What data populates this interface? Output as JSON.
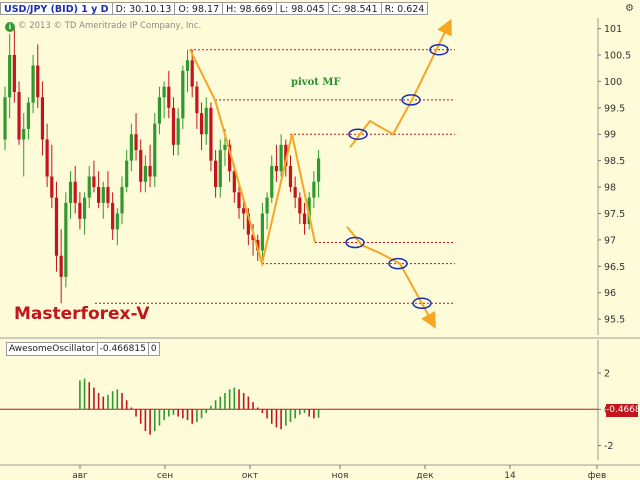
{
  "header": {
    "symbol": "USD/JPY (BID) 1 y D",
    "date": "D: 30.10.13",
    "open": "O: 98.17",
    "high": "H: 98.669",
    "low": "L: 98.045",
    "close": "C: 98.541",
    "range": "R: 0.624"
  },
  "copyright": "© 2013 © TD Ameritrade IP Company, Inc.",
  "signature": "Masterforex-V",
  "pivot_label": "pivot MF",
  "oscillator": {
    "name": "AwesomeOscillator",
    "value": "-0.466815",
    "extra": "0",
    "last_value": "-0.4668"
  },
  "colors": {
    "background": "#fdfbd8",
    "up_candle": "#2e9a2e",
    "down_candle": "#c4141c",
    "forecast": "#f5a623",
    "level_line": "#c4141c",
    "ellipse": "#1a2fb0"
  },
  "chart_data": [
    {
      "type": "candlestick",
      "title": "USD/JPY (BID) 1 y D",
      "ylim": [
        95.2,
        101.2
      ],
      "yticks": [
        95.5,
        96,
        96.5,
        97,
        97.5,
        98,
        98.5,
        99,
        99.5,
        100,
        100.5,
        101
      ],
      "xticks": [
        "авг",
        "сен",
        "окт",
        "ноя",
        "дек",
        "14",
        "фев"
      ],
      "candles": [
        [
          98.9,
          99.9,
          98.7,
          99.7
        ],
        [
          99.7,
          100.9,
          99.3,
          100.5
        ],
        [
          100.5,
          101.0,
          99.6,
          99.8
        ],
        [
          99.8,
          100.0,
          98.8,
          98.9
        ],
        [
          98.9,
          99.4,
          98.2,
          99.1
        ],
        [
          99.1,
          99.7,
          98.9,
          99.6
        ],
        [
          99.6,
          100.5,
          99.4,
          100.3
        ],
        [
          100.3,
          100.7,
          99.5,
          99.7
        ],
        [
          99.7,
          100.0,
          98.6,
          98.9
        ],
        [
          98.9,
          99.2,
          98.0,
          98.2
        ],
        [
          98.2,
          98.8,
          97.6,
          97.8
        ],
        [
          97.8,
          98.1,
          96.4,
          96.7
        ],
        [
          96.7,
          97.2,
          95.8,
          96.3
        ],
        [
          96.3,
          97.9,
          96.1,
          97.7
        ],
        [
          97.7,
          98.3,
          97.4,
          98.1
        ],
        [
          98.1,
          98.4,
          97.5,
          97.7
        ],
        [
          97.7,
          97.9,
          97.2,
          97.4
        ],
        [
          97.4,
          97.9,
          97.1,
          97.8
        ],
        [
          97.8,
          98.4,
          97.6,
          98.2
        ],
        [
          98.2,
          98.5,
          97.9,
          98.0
        ],
        [
          98.0,
          98.3,
          97.6,
          97.7
        ],
        [
          97.7,
          98.1,
          97.4,
          98.0
        ],
        [
          98.0,
          98.3,
          97.6,
          97.7
        ],
        [
          97.7,
          97.9,
          97.0,
          97.2
        ],
        [
          97.2,
          97.6,
          96.9,
          97.5
        ],
        [
          97.5,
          98.2,
          97.3,
          98.0
        ],
        [
          98.0,
          98.7,
          97.9,
          98.5
        ],
        [
          98.5,
          99.2,
          98.3,
          99.0
        ],
        [
          99.0,
          99.4,
          98.5,
          98.7
        ],
        [
          98.7,
          98.9,
          97.9,
          98.1
        ],
        [
          98.1,
          98.6,
          97.9,
          98.4
        ],
        [
          98.4,
          98.8,
          98.0,
          98.2
        ],
        [
          98.2,
          99.4,
          98.0,
          99.2
        ],
        [
          99.2,
          99.9,
          99.0,
          99.7
        ],
        [
          99.7,
          100.0,
          99.3,
          99.9
        ],
        [
          99.9,
          100.2,
          99.3,
          99.5
        ],
        [
          99.5,
          99.7,
          98.6,
          98.8
        ],
        [
          98.8,
          99.5,
          98.6,
          99.3
        ],
        [
          99.3,
          100.3,
          99.1,
          100.2
        ],
        [
          100.2,
          100.6,
          99.8,
          100.4
        ],
        [
          100.4,
          100.6,
          99.7,
          99.9
        ],
        [
          99.9,
          100.0,
          99.1,
          99.4
        ],
        [
          99.4,
          99.6,
          98.7,
          99.0
        ],
        [
          99.0,
          99.7,
          98.8,
          99.5
        ],
        [
          99.5,
          99.6,
          98.3,
          98.5
        ],
        [
          98.5,
          98.7,
          97.8,
          98.0
        ],
        [
          98.0,
          98.9,
          97.8,
          98.7
        ],
        [
          98.7,
          99.1,
          98.4,
          98.8
        ],
        [
          98.8,
          98.9,
          98.1,
          98.3
        ],
        [
          98.3,
          98.4,
          97.7,
          97.9
        ],
        [
          97.9,
          98.1,
          97.4,
          97.6
        ],
        [
          97.6,
          97.8,
          97.2,
          97.5
        ],
        [
          97.5,
          97.6,
          96.9,
          97.1
        ],
        [
          97.1,
          97.3,
          96.7,
          97.0
        ],
        [
          97.0,
          97.1,
          96.6,
          96.8
        ],
        [
          96.8,
          97.7,
          96.6,
          97.5
        ],
        [
          97.5,
          97.9,
          97.2,
          97.8
        ],
        [
          97.8,
          98.6,
          97.7,
          98.4
        ],
        [
          98.4,
          98.8,
          98.1,
          98.3
        ],
        [
          98.3,
          99.0,
          98.2,
          98.8
        ],
        [
          98.8,
          98.9,
          98.2,
          98.4
        ],
        [
          98.4,
          98.6,
          97.9,
          98.0
        ],
        [
          98.0,
          98.2,
          97.6,
          97.8
        ],
        [
          97.8,
          97.9,
          97.3,
          97.5
        ],
        [
          97.5,
          97.7,
          97.1,
          97.3
        ],
        [
          97.3,
          97.9,
          97.2,
          97.8
        ],
        [
          97.8,
          98.3,
          97.6,
          98.1
        ],
        [
          98.1,
          98.7,
          97.8,
          98.541
        ]
      ],
      "levels": [
        100.6,
        99.65,
        99.0,
        96.95,
        96.55,
        95.8
      ],
      "forecast_up": [
        [
          96.95,
          98.9
        ],
        [
          97.95,
          99.25
        ],
        [
          106.9,
          99.0
        ],
        [
          107.0,
          99.65
        ],
        [
          107.0,
          101.0
        ]
      ],
      "forecast_down": [
        [
          96.95,
          97.3
        ],
        [
          97.0,
          96.95
        ],
        [
          101.3,
          96.75
        ],
        [
          102.0,
          96.55
        ],
        [
          107.0,
          95.5
        ]
      ],
      "pattern": [
        [
          100.6,
          100.6
        ],
        [
          99.65,
          99.6
        ],
        [
          96.55,
          96.55
        ],
        [
          99.0,
          99.0
        ],
        [
          96.95,
          96.95
        ]
      ]
    },
    {
      "type": "bar",
      "title": "AwesomeOscillator",
      "ylim": [
        -2.8,
        3.0
      ],
      "yticks": [
        -2,
        0,
        2
      ],
      "values": [
        1.6,
        1.7,
        1.5,
        1.2,
        0.9,
        0.7,
        0.8,
        1.0,
        1.1,
        0.9,
        0.5,
        0.1,
        -0.4,
        -0.8,
        -1.2,
        -1.4,
        -1.2,
        -0.9,
        -0.6,
        -0.4,
        -0.3,
        -0.4,
        -0.5,
        -0.6,
        -0.8,
        -0.7,
        -0.5,
        -0.2,
        0.2,
        0.5,
        0.7,
        0.9,
        1.1,
        1.2,
        1.1,
        0.9,
        0.7,
        0.4,
        0.1,
        -0.2,
        -0.5,
        -0.8,
        -1.0,
        -1.1,
        -0.9,
        -0.7,
        -0.5,
        -0.3,
        -0.2,
        -0.4,
        -0.5,
        -0.4667
      ]
    }
  ]
}
